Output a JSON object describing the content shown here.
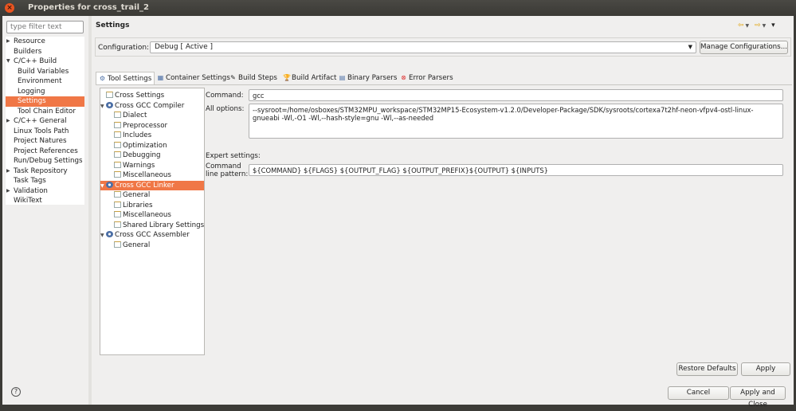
{
  "window": {
    "title": "Properties for cross_trail_2",
    "close_glyph": "×"
  },
  "filter": {
    "placeholder": "type filter text"
  },
  "nav": [
    {
      "label": "Resource",
      "expandable": true
    },
    {
      "label": "Builders",
      "expandable": false
    },
    {
      "label": "C/C++ Build",
      "expandable": true,
      "expanded": true
    },
    {
      "label": "Build Variables",
      "child": true
    },
    {
      "label": "Environment",
      "child": true
    },
    {
      "label": "Logging",
      "child": true
    },
    {
      "label": "Settings",
      "child": true,
      "selected": true
    },
    {
      "label": "Tool Chain Editor",
      "child": true
    },
    {
      "label": "C/C++ General",
      "expandable": true
    },
    {
      "label": "Linux Tools Path"
    },
    {
      "label": "Project Natures"
    },
    {
      "label": "Project References"
    },
    {
      "label": "Run/Debug Settings"
    },
    {
      "label": "Task Repository",
      "expandable": true
    },
    {
      "label": "Task Tags"
    },
    {
      "label": "Validation",
      "expandable": true
    },
    {
      "label": "WikiText"
    }
  ],
  "page": {
    "heading": "Settings"
  },
  "configuration": {
    "label": "Configuration:",
    "value": "Debug  [ Active ]",
    "manage_button": "Manage Configurations..."
  },
  "tabs": [
    {
      "label": "Tool Settings",
      "icon": "tool-settings-icon",
      "selected": true
    },
    {
      "label": "Container Settings",
      "icon": "container-icon"
    },
    {
      "label": "Build Steps",
      "icon": "build-steps-icon"
    },
    {
      "label": "Build Artifact",
      "icon": "build-artifact-icon"
    },
    {
      "label": "Binary Parsers",
      "icon": "binary-parsers-icon"
    },
    {
      "label": "Error Parsers",
      "icon": "error-parsers-icon"
    }
  ],
  "tool_tree": [
    {
      "label": "Cross Settings",
      "level": 0,
      "icon": "settings-page-icon"
    },
    {
      "label": "Cross GCC Compiler",
      "level": 0,
      "icon": "tool-gear-icon",
      "expanded": true
    },
    {
      "label": "Dialect",
      "level": 1,
      "icon": "settings-page-icon"
    },
    {
      "label": "Preprocessor",
      "level": 1,
      "icon": "settings-page-icon"
    },
    {
      "label": "Includes",
      "level": 1,
      "icon": "settings-page-icon"
    },
    {
      "label": "Optimization",
      "level": 1,
      "icon": "settings-page-icon"
    },
    {
      "label": "Debugging",
      "level": 1,
      "icon": "settings-page-icon"
    },
    {
      "label": "Warnings",
      "level": 1,
      "icon": "settings-page-icon"
    },
    {
      "label": "Miscellaneous",
      "level": 1,
      "icon": "settings-page-icon"
    },
    {
      "label": "Cross GCC Linker",
      "level": 0,
      "icon": "tool-gear-icon",
      "expanded": true,
      "selected": true
    },
    {
      "label": "General",
      "level": 1,
      "icon": "settings-page-icon"
    },
    {
      "label": "Libraries",
      "level": 1,
      "icon": "settings-page-icon"
    },
    {
      "label": "Miscellaneous",
      "level": 1,
      "icon": "settings-page-icon"
    },
    {
      "label": "Shared Library Settings",
      "level": 1,
      "icon": "settings-page-icon"
    },
    {
      "label": "Cross GCC Assembler",
      "level": 0,
      "icon": "tool-gear-icon",
      "expanded": true
    },
    {
      "label": "General",
      "level": 1,
      "icon": "settings-page-icon"
    }
  ],
  "settings": {
    "command_label": "Command:",
    "command_value": "gcc",
    "all_options_label": "All options:",
    "all_options_value": "--sysroot=/home/osboxes/STM32MPU_workspace/STM32MP15-Ecosystem-v1.2.0/Developer-Package/SDK/sysroots/cortexa7t2hf-neon-vfpv4-ostl-linux-gnueabi -Wl,-O1 -Wl,--hash-style=gnu -Wl,--as-needed",
    "expert_label": "Expert settings:",
    "pattern_label_1": "Command",
    "pattern_label_2": "line pattern:",
    "pattern_value": "${COMMAND} ${FLAGS} ${OUTPUT_FLAG} ${OUTPUT_PREFIX}${OUTPUT} ${INPUTS}"
  },
  "buttons": {
    "restore_defaults": "Restore Defaults",
    "apply": "Apply",
    "cancel": "Cancel",
    "apply_close": "Apply and Close"
  },
  "help_glyph": "?",
  "colors": {
    "selection": "#f07746",
    "titlebar": "#3c3b37",
    "dialog_bg": "#f0efee"
  }
}
